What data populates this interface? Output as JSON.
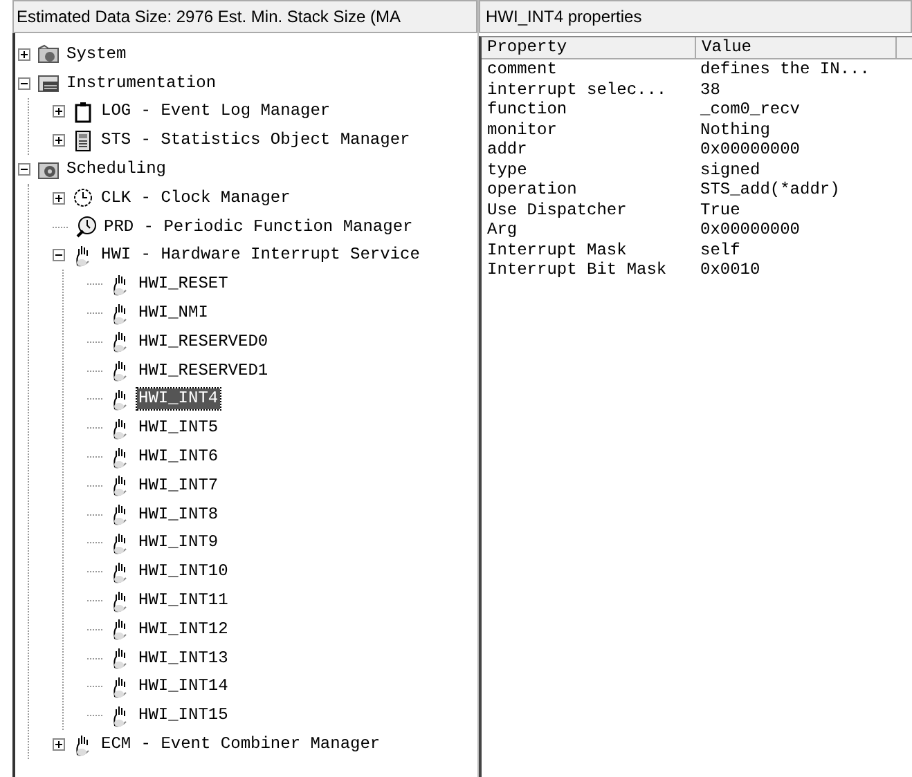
{
  "tree_panel": {
    "title": "Estimated Data Size: 2976   Est. Min. Stack Size (MA",
    "tree": [
      {
        "label": "System",
        "kind": "system",
        "expanded": false,
        "selected": false
      },
      {
        "label": "Instrumentation",
        "kind": "instrumentation",
        "expanded": true,
        "selected": false,
        "children": [
          {
            "label": "LOG - Event Log Manager",
            "kind": "log",
            "expanded": false,
            "selected": false
          },
          {
            "label": "STS - Statistics Object Manager",
            "kind": "sts",
            "expanded": false,
            "selected": false
          }
        ]
      },
      {
        "label": "Scheduling",
        "kind": "scheduling",
        "expanded": true,
        "selected": false,
        "children": [
          {
            "label": "CLK - Clock Manager",
            "kind": "clock",
            "expanded": false,
            "selected": false
          },
          {
            "label": "PRD - Periodic Function Manager",
            "kind": "periodic",
            "selected": false
          },
          {
            "label": "HWI - Hardware Interrupt Service",
            "kind": "interrupt",
            "expanded": true,
            "selected": false,
            "children": [
              {
                "label": "HWI_RESET",
                "kind": "interrupt",
                "selected": false
              },
              {
                "label": "HWI_NMI",
                "kind": "interrupt",
                "selected": false
              },
              {
                "label": "HWI_RESERVED0",
                "kind": "interrupt",
                "selected": false
              },
              {
                "label": "HWI_RESERVED1",
                "kind": "interrupt",
                "selected": false
              },
              {
                "label": "HWI_INT4",
                "kind": "interrupt",
                "selected": true
              },
              {
                "label": "HWI_INT5",
                "kind": "interrupt",
                "selected": false
              },
              {
                "label": "HWI_INT6",
                "kind": "interrupt",
                "selected": false
              },
              {
                "label": "HWI_INT7",
                "kind": "interrupt",
                "selected": false
              },
              {
                "label": "HWI_INT8",
                "kind": "interrupt",
                "selected": false
              },
              {
                "label": "HWI_INT9",
                "kind": "interrupt",
                "selected": false
              },
              {
                "label": "HWI_INT10",
                "kind": "interrupt",
                "selected": false
              },
              {
                "label": "HWI_INT11",
                "kind": "interrupt",
                "selected": false
              },
              {
                "label": "HWI_INT12",
                "kind": "interrupt",
                "selected": false
              },
              {
                "label": "HWI_INT13",
                "kind": "interrupt",
                "selected": false
              },
              {
                "label": "HWI_INT14",
                "kind": "interrupt",
                "selected": false
              },
              {
                "label": "HWI_INT15",
                "kind": "interrupt",
                "selected": false
              }
            ]
          },
          {
            "label": "ECM - Event Combiner Manager",
            "kind": "interrupt",
            "expanded": false,
            "selected": false
          }
        ]
      }
    ]
  },
  "properties_panel": {
    "title": "HWI_INT4 properties",
    "columns": [
      "Property",
      "Value"
    ],
    "rows": [
      [
        "comment",
        "defines the IN..."
      ],
      [
        "interrupt selec...",
        "38"
      ],
      [
        "function",
        "_com0_recv"
      ],
      [
        "monitor",
        "Nothing"
      ],
      [
        "addr",
        "0x00000000"
      ],
      [
        "type",
        "signed"
      ],
      [
        "operation",
        "STS_add(*addr)"
      ],
      [
        "Use Dispatcher",
        "True"
      ],
      [
        "Arg",
        "0x00000000"
      ],
      [
        "Interrupt Mask",
        "self"
      ],
      [
        "Interrupt Bit Mask",
        "0x0010"
      ]
    ]
  }
}
